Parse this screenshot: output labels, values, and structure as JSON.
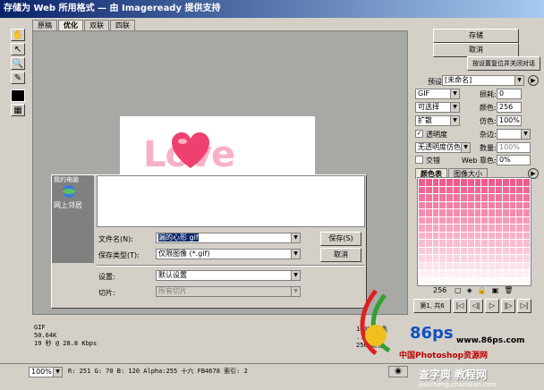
{
  "window": {
    "title": "存储为 Web 所用格式 — 由 Imageready 提供支持"
  },
  "tabs": [
    "原稿",
    "优化",
    "双联",
    "四联"
  ],
  "image": {
    "text": "Love",
    "desktop_items": [
      "我的电脑",
      "网上邻居"
    ]
  },
  "save_dialog": {
    "filename_label": "文件名(N):",
    "filename_value": "漏的心形 gif",
    "filetype_label": "保存类型(T):",
    "filetype_value": "仅限图像 (*.gif)",
    "settings_label": "设置:",
    "settings_value": "默认设置",
    "slices_label": "切片:",
    "slices_value": "所有切片",
    "save_label": "保存(S)",
    "cancel_label": "取消"
  },
  "right_panel": {
    "save_label": "存储",
    "cancel_label": "取消",
    "reset_label": "按设置复位并关闭对话",
    "preset_label": "预设:",
    "preset_value": "[未命名]",
    "format_value": "GIF",
    "lossy_label": "损耗:",
    "lossy_value": "0",
    "reduction_value": "可选择",
    "colors_label": "颜色:",
    "colors_value": "256",
    "dither_algo_value": "扩散",
    "dither_label": "仿色:",
    "dither_value": "100%",
    "transparency_label": "透明度",
    "matte_label": "杂边:",
    "trans_dither_value": "无透明度仿色",
    "amount_label": "数量:",
    "amount_value": "100%",
    "interlaced_label": "交错",
    "web_snap_label": "Web 靠色:",
    "web_snap_value": "0%",
    "color_table_tab": "颜色表",
    "image_size_tab": "图像大小",
    "color_count": "256",
    "frame_label": "第1, 共6"
  },
  "info": {
    "line1": "GIF",
    "line2": "50.64K",
    "line3": "19 秒 @ 28.8 Kbps",
    "right1": "100% 仿色",
    "right2": "...色板",
    "right3": "256 颜色"
  },
  "status": {
    "zoom": "100%",
    "readout": "R: 251  G: 70  B: 120  Alpha:255  十六 FB4678  索引: 2"
  },
  "watermark": {
    "brand": "86ps",
    "url": "www.86ps.com",
    "site": "中国Photoshop资源网",
    "bottom": "查字典 教程网",
    "bottom_url": "jiaocheng.chazidian.com"
  }
}
